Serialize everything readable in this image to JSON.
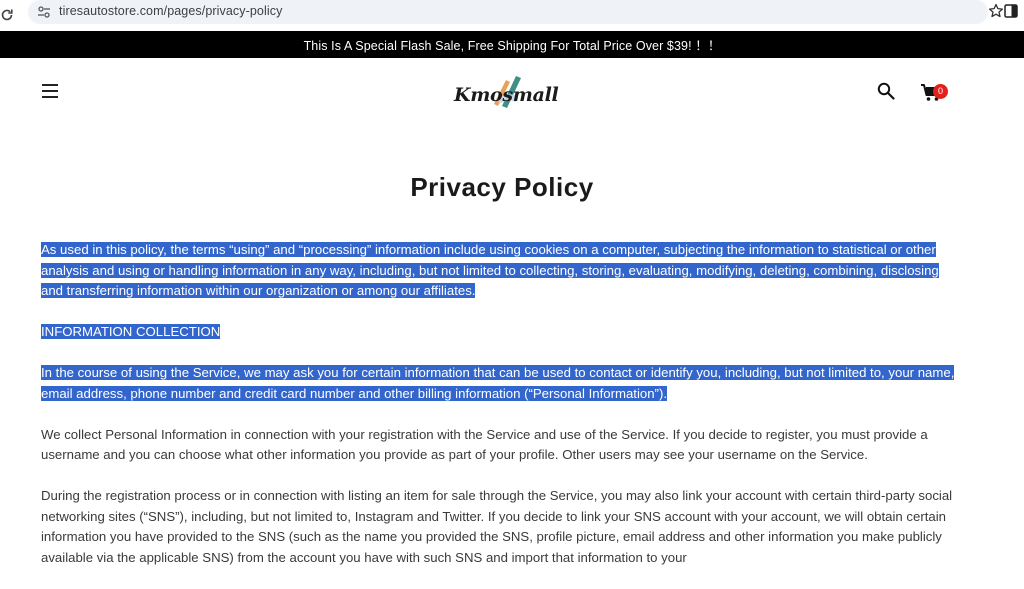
{
  "browser": {
    "url": "tiresautostore.com/pages/privacy-policy",
    "icons": {
      "reload": "reload-icon",
      "site_info": "site-info-icon",
      "bookmark": "star-icon",
      "side_panel": "side-panel-icon"
    }
  },
  "announcement": {
    "text": "This Is A Special Flash Sale, Free Shipping For Total Price Over $39! ！！"
  },
  "header": {
    "logo_text": "Kmosmall",
    "cart_count": "0",
    "icons": {
      "menu": "hamburger-menu-icon",
      "search": "search-icon",
      "cart": "cart-icon"
    }
  },
  "page": {
    "title": "Privacy Policy",
    "paragraphs": [
      "As used in this policy, the terms “using” and “processing” information include using cookies on a computer, subjecting the information to statistical or other analysis and using or handling information in any way, including, but not limited to collecting, storing, evaluating, modifying, deleting, combining, disclosing and transferring information within our organization or among our affiliates.",
      "INFORMATION COLLECTION",
      "In the course of using the Service, we may ask you for certain information that can be used to contact or identify you, including, but not limited to, your name, email address, phone number and credit card number and other billing information (“Personal Information”).",
      "We collect Personal Information in connection with your registration with the Service and use of the Service. If you decide to register, you must provide a username and you can choose what other information you provide as part of your profile. Other users may see your username on the Service.",
      "During the registration process or in connection with listing an item for sale through the Service, you may also link your account with certain third-party social networking sites (“SNS”), including, but not limited to, Instagram and Twitter. If you decide to link your SNS account with your account, we will obtain certain information you have provided to the SNS (such as the name you provided the SNS, profile picture, email address and other information you make publicly available via the applicable SNS) from the account you have with such SNS and import that information to your"
    ]
  },
  "colors": {
    "announcement_bg": "#000000",
    "selection_bg": "#3366cc",
    "cart_badge": "#e4201c",
    "address_bar_bg": "#eff3f8"
  }
}
